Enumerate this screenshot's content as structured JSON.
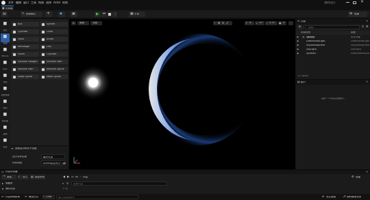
{
  "menubar": {
    "items": [
      "文件",
      "编辑",
      "窗口",
      "工具",
      "构建",
      "选择",
      "Actor",
      "帮助"
    ],
    "project_name": "我的项目"
  },
  "tab": {
    "label": "无标题"
  },
  "toolbar": {
    "save_label": "保存",
    "mode_label": "选择模式",
    "platform_label": "平台",
    "settings_label": "设置"
  },
  "left_rail": {
    "items": [
      {
        "label": "最近",
        "icon": "clock-icon"
      },
      {
        "label": "基础",
        "icon": "cube-icon",
        "active": true
      },
      {
        "label": "Effects",
        "icon": "sparkle-icon"
      },
      {
        "label": "形状",
        "icon": "shapes-icon"
      },
      {
        "label": "光照",
        "icon": "light-icon"
      },
      {
        "label": "视觉效果",
        "icon": "eye-icon"
      },
      {
        "label": "体积",
        "icon": "volume-icon"
      },
      {
        "label": "所有类",
        "icon": "list-icon"
      },
      {
        "label": "其他",
        "icon": "puzzle-icon"
      },
      {
        "label": "设置",
        "icon": "gear-icon"
      }
    ]
  },
  "place_actors": {
    "items": [
      {
        "label": "Box",
        "icon": "box-icon"
      },
      {
        "label": "Sphere",
        "icon": "sphere-icon"
      },
      {
        "label": "Cylinder",
        "icon": "cylinder-icon"
      },
      {
        "label": "Cone",
        "icon": "cone-icon"
      },
      {
        "label": "Torus",
        "icon": "torus-icon"
      },
      {
        "label": "Arrow",
        "icon": "arrow-icon"
      },
      {
        "label": "Rectangle",
        "icon": "rectangle-icon"
      },
      {
        "label": "Disc",
        "icon": "disc-icon"
      },
      {
        "label": "Stairs",
        "icon": "stairs-icon"
      },
      {
        "label": "Cylinder",
        "icon": "cylinder-icon"
      },
      {
        "label": "Extrude Polygon",
        "icon": "polygon-icon"
      },
      {
        "label": "Extrude Path",
        "icon": "path-icon"
      },
      {
        "label": "Revolve Path",
        "icon": "revolve-icon"
      },
      {
        "label": "Revolve Spline",
        "icon": "spline-icon"
      },
      {
        "label": "Draw Spline",
        "icon": "draw-icon"
      },
      {
        "label": "Mesh Spline",
        "icon": "mesh-icon"
      }
    ]
  },
  "detail_panel": {
    "title": "视频显示和关卡设置",
    "rows": [
      {
        "label": "显示名称层级",
        "value": "最大可用"
      },
      {
        "label": "标准视图",
        "value": "Actors实际大小（通过视图）"
      }
    ]
  },
  "viewport": {
    "view_label": "透视",
    "lit_label": "光照",
    "grid_value": "10",
    "angle_value": "10°",
    "scale_value": "0.25",
    "camera_speed": "4"
  },
  "outliner": {
    "title": "大纲",
    "search_placeholder": "搜索...",
    "col_label": "项目标签",
    "col_type": "类型",
    "items": [
      {
        "label": "无（编辑器）",
        "type": "世界场景",
        "indent": 0
      },
      {
        "label": "DirectionalLight",
        "type": "DirectionalLight",
        "indent": 1
      },
      {
        "label": "SkyAtmosphere",
        "type": "SkyAtmosphere",
        "indent": 1
      },
      {
        "label": "SkyLight",
        "type": "SkyLight",
        "indent": 1
      },
      {
        "label": "Sphere2",
        "type": "StaticMeshActor",
        "indent": 1
      }
    ],
    "count": "4个Actor"
  },
  "details": {
    "title": "细节",
    "empty_hint": "选择一个对象来查看细节。"
  },
  "content_browser": {
    "title": "内容浏览器",
    "add_label": "添加",
    "import_label": "导入",
    "save_all_label": "保存所有",
    "path": [
      "All",
      "内容"
    ],
    "settings_label": "设置",
    "favorites_label": "收藏夹",
    "project_label": "我的项目",
    "search_placeholder": "搜索内容",
    "item_count": "0 项",
    "collections_label": "集合"
  },
  "statusbar": {
    "content_drawer": "内容侧滑菜单",
    "output_log": "输出日志",
    "cmd_label": "Cmd",
    "console_placeholder": "输入控制台命令",
    "derived_data": "派生数据",
    "source_control": "源码管理关闭"
  }
}
